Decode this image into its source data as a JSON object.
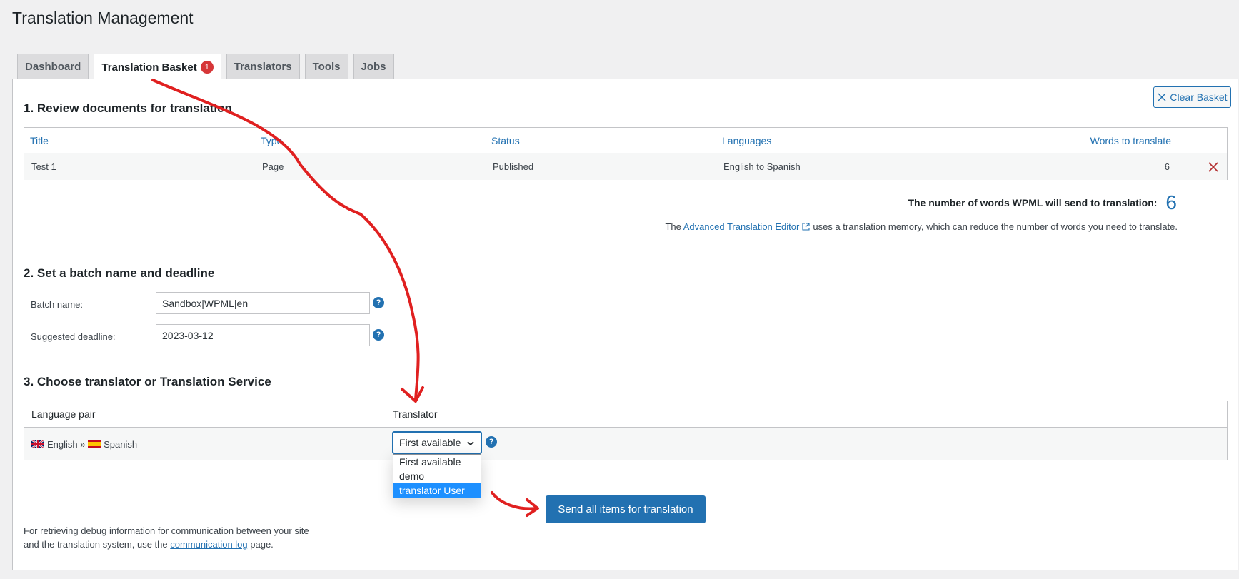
{
  "page": {
    "title": "Translation Management"
  },
  "tabs": [
    {
      "label": "Dashboard"
    },
    {
      "label": "Translation Basket",
      "badge": "1"
    },
    {
      "label": "Translators"
    },
    {
      "label": "Tools"
    },
    {
      "label": "Jobs"
    }
  ],
  "basket": {
    "clear_label": "Clear Basket"
  },
  "section1": {
    "title": "1. Review documents for translation",
    "columns": [
      "Title",
      "Type",
      "Status",
      "Languages",
      "Words to translate"
    ],
    "rows": [
      {
        "title": "Test 1",
        "type": "Page",
        "status": "Published",
        "languages": "English to Spanish",
        "words": "6"
      }
    ],
    "word_count_label": "The number of words WPML will send to translation:",
    "word_count_value": "6",
    "ate_prefix": "The",
    "ate_link": "Advanced Translation Editor",
    "ate_suffix": "uses a translation memory, which can reduce the number of words you need to translate."
  },
  "section2": {
    "title": "2. Set a batch name and deadline",
    "batch_label": "Batch name:",
    "batch_value": "Sandbox|WPML|en",
    "deadline_label": "Suggested deadline:",
    "deadline_value": "2023-03-12",
    "help": "?"
  },
  "section3": {
    "title": "3. Choose translator or Translation Service",
    "col_pair": "Language pair",
    "col_translator": "Translator",
    "from_lang": "English",
    "separator": "»",
    "to_lang": "Spanish",
    "selected": "First available",
    "options": [
      "First available",
      "demo",
      "translator User"
    ],
    "highlighted_option": "translator User"
  },
  "actions": {
    "send_label": "Send all items for translation"
  },
  "debug": {
    "prefix": "For retrieving debug information for communication between your site and the translation system, use the",
    "link": "communication log",
    "suffix": "page."
  },
  "colors": {
    "accent": "#2271b1",
    "danger": "#d63638",
    "annotation": "#e02020"
  }
}
